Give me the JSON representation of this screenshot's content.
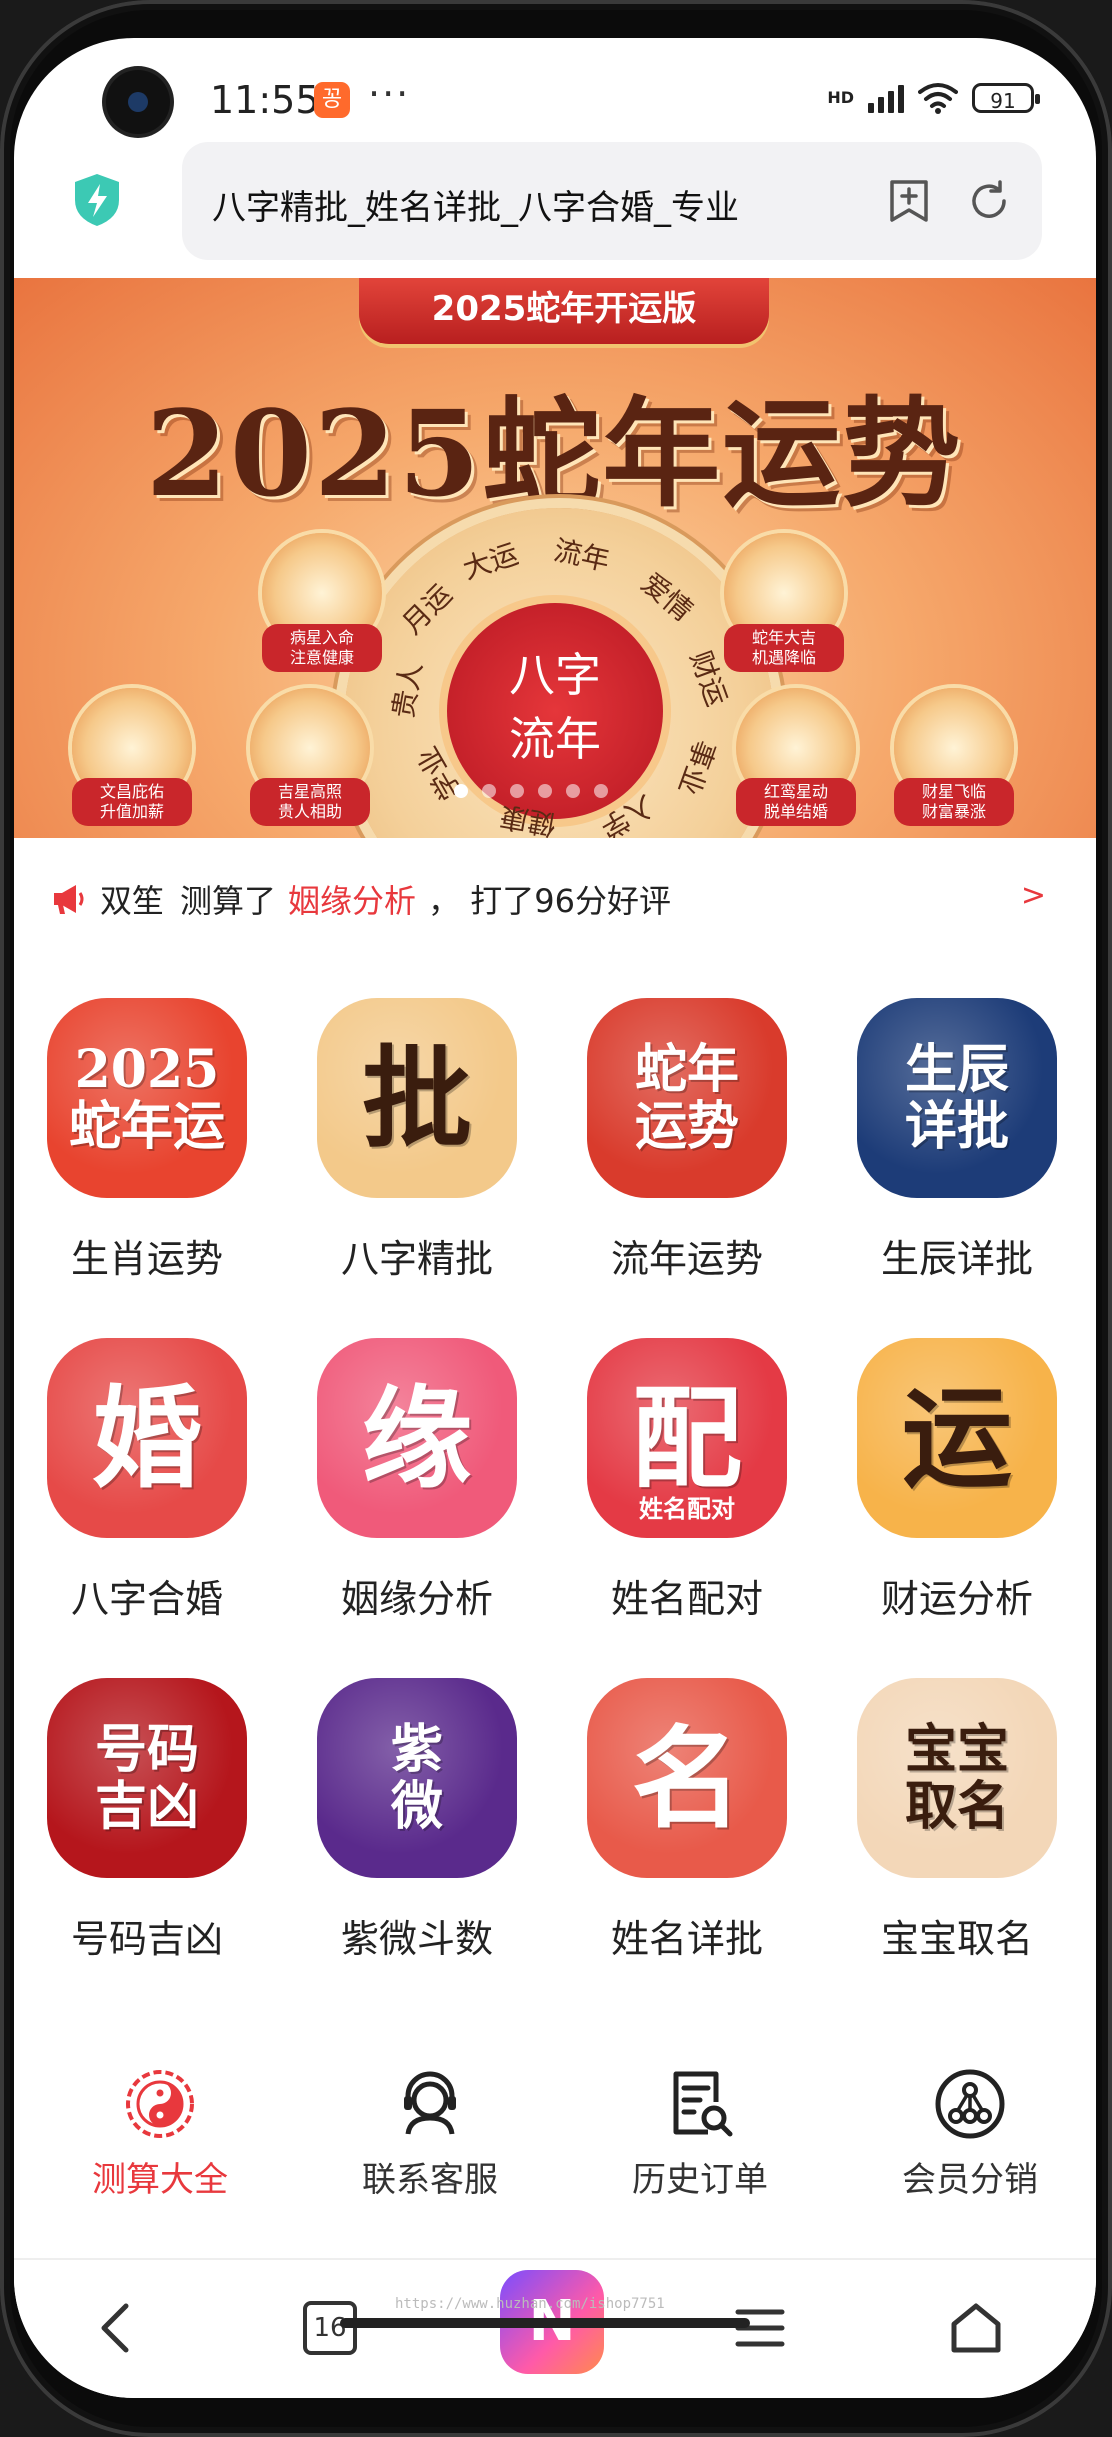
{
  "status_bar": {
    "time": "11:55",
    "network": "HD",
    "battery": "91",
    "more": "···"
  },
  "url_bar": {
    "text": "八字精批_姓名详批_八字合婚_专业"
  },
  "banner": {
    "ribbon": "2025蛇年开运版",
    "title": "2025蛇年运势",
    "center_top": "八字",
    "center_bottom": "流年",
    "wheel_words": [
      "大运",
      "流年",
      "爱情",
      "财运",
      "事业",
      "入学",
      "健康",
      "学业",
      "贵人",
      "月运"
    ],
    "badges": [
      {
        "label": "病星入命\n注意健康"
      },
      {
        "label": "蛇年大吉\n机遇降临"
      },
      {
        "label": "文昌庇佑\n升值加薪"
      },
      {
        "label": "吉星高照\n贵人相助"
      },
      {
        "label": "红鸾星动\n脱单结婚"
      },
      {
        "label": "财星飞临\n财富暴涨"
      }
    ],
    "slides": 6,
    "active_slide": 1
  },
  "notice": {
    "user": "双笙",
    "action": "测算了",
    "item": "姻缘分析",
    "result": "，  打了96分好评",
    "arrow": ">"
  },
  "services": [
    {
      "label": "生肖运势",
      "glyph": "2025\n蛇年运",
      "bg": "#e8442f"
    },
    {
      "label": "八字精批",
      "glyph": "批",
      "bg": "#f3c98a"
    },
    {
      "label": "流年运势",
      "glyph": "蛇年\n运势",
      "bg": "#d93b2c"
    },
    {
      "label": "生辰详批",
      "glyph": "生辰\n详批",
      "bg": "#1d3c78"
    },
    {
      "label": "八字合婚",
      "glyph": "婚",
      "bg": "#e64a48"
    },
    {
      "label": "姻缘分析",
      "glyph": "缘",
      "bg": "#f05a7a"
    },
    {
      "label": "姓名配对",
      "glyph": "配",
      "sub": "姓名配对",
      "bg": "#e43a45"
    },
    {
      "label": "财运分析",
      "glyph": "运",
      "bg": "#f7b34a"
    },
    {
      "label": "号码吉凶",
      "glyph": "号码\n吉凶",
      "bg": "#b5161c"
    },
    {
      "label": "紫微斗数",
      "glyph": "紫\n微",
      "bg": "#5a2a8c"
    },
    {
      "label": "姓名详批",
      "glyph": "名",
      "bg": "#e85a4a"
    },
    {
      "label": "宝宝取名",
      "glyph": "宝宝\n取名",
      "bg": "#f3d7b8"
    }
  ],
  "app_nav": [
    {
      "label": "测算大全",
      "icon": "yin-yang-icon",
      "active": true
    },
    {
      "label": "联系客服",
      "icon": "headset-icon"
    },
    {
      "label": "历史订单",
      "icon": "order-search-icon"
    },
    {
      "label": "会员分销",
      "icon": "share-network-icon"
    }
  ],
  "toolbar": {
    "tabs_count": "16",
    "ai_label": "N"
  },
  "watermark": "https://www.huzhan.com/ishop7751",
  "colors": {
    "accent": "#e8383d",
    "text": "#222222",
    "url_bg": "#f2f2f4"
  }
}
